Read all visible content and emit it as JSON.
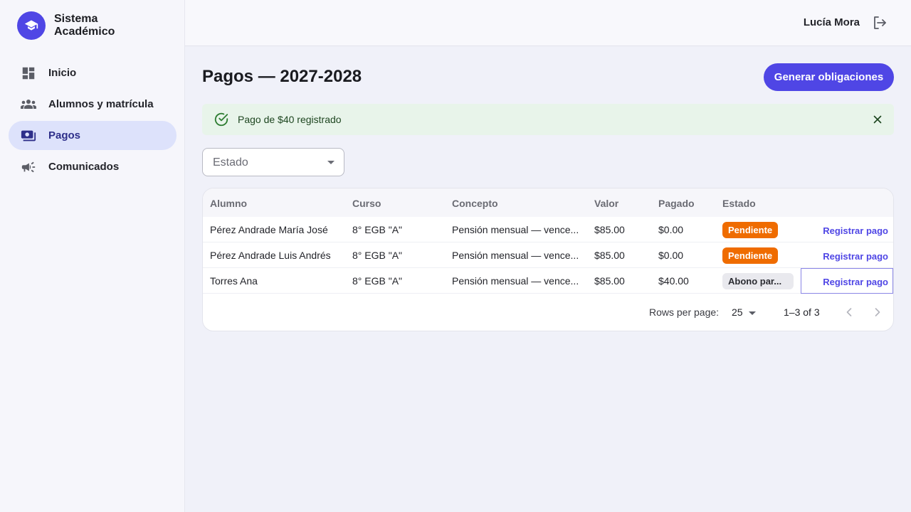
{
  "app": {
    "brand_line1": "Sistema",
    "brand_line2": "Académico",
    "logo_icon": "graduation-cap-icon"
  },
  "sidebar": {
    "items": [
      {
        "label": "Inicio",
        "icon": "dashboard-icon",
        "active": false
      },
      {
        "label": "Alumnos y matrícula",
        "icon": "people-icon",
        "active": false
      },
      {
        "label": "Pagos",
        "icon": "payments-icon",
        "active": true
      },
      {
        "label": "Comunicados",
        "icon": "megaphone-icon",
        "active": false
      }
    ]
  },
  "header": {
    "user_name": "Lucía Mora",
    "logout_icon": "logout-icon"
  },
  "page": {
    "title": "Pagos — 2027-2028",
    "primary_action": "Generar obligaciones"
  },
  "alert": {
    "message": "Pago de $40 registrado",
    "icon": "check-circle-icon",
    "close_icon": "close-icon"
  },
  "filter": {
    "label": "Estado",
    "value": ""
  },
  "table": {
    "columns": [
      "Alumno",
      "Curso",
      "Concepto",
      "Valor",
      "Pagado",
      "Estado"
    ],
    "rows": [
      {
        "alumno": "Pérez Andrade María José",
        "curso": "8° EGB \"A\"",
        "concepto": "Pensión mensual — vence...",
        "valor": "$85.00",
        "pagado": "$0.00",
        "estado": "Pendiente",
        "estado_kind": "pending",
        "action": "Registrar pago"
      },
      {
        "alumno": "Pérez Andrade Luis Andrés",
        "curso": "8° EGB \"A\"",
        "concepto": "Pensión mensual — vence...",
        "valor": "$85.00",
        "pagado": "$0.00",
        "estado": "Pendiente",
        "estado_kind": "pending",
        "action": "Registrar pago"
      },
      {
        "alumno": "Torres Ana",
        "curso": "8° EGB \"A\"",
        "concepto": "Pensión mensual — vence...",
        "valor": "$85.00",
        "pagado": "$40.00",
        "estado": "Abono par...",
        "estado_kind": "partial",
        "action": "Registrar pago"
      }
    ]
  },
  "pagination": {
    "rows_per_page_label": "Rows per page:",
    "rows_per_page": "25",
    "range": "1–3 of 3"
  },
  "colors": {
    "accent": "#4f46e5",
    "pending": "#ef6c00",
    "success_bg": "#e8f4ea"
  }
}
